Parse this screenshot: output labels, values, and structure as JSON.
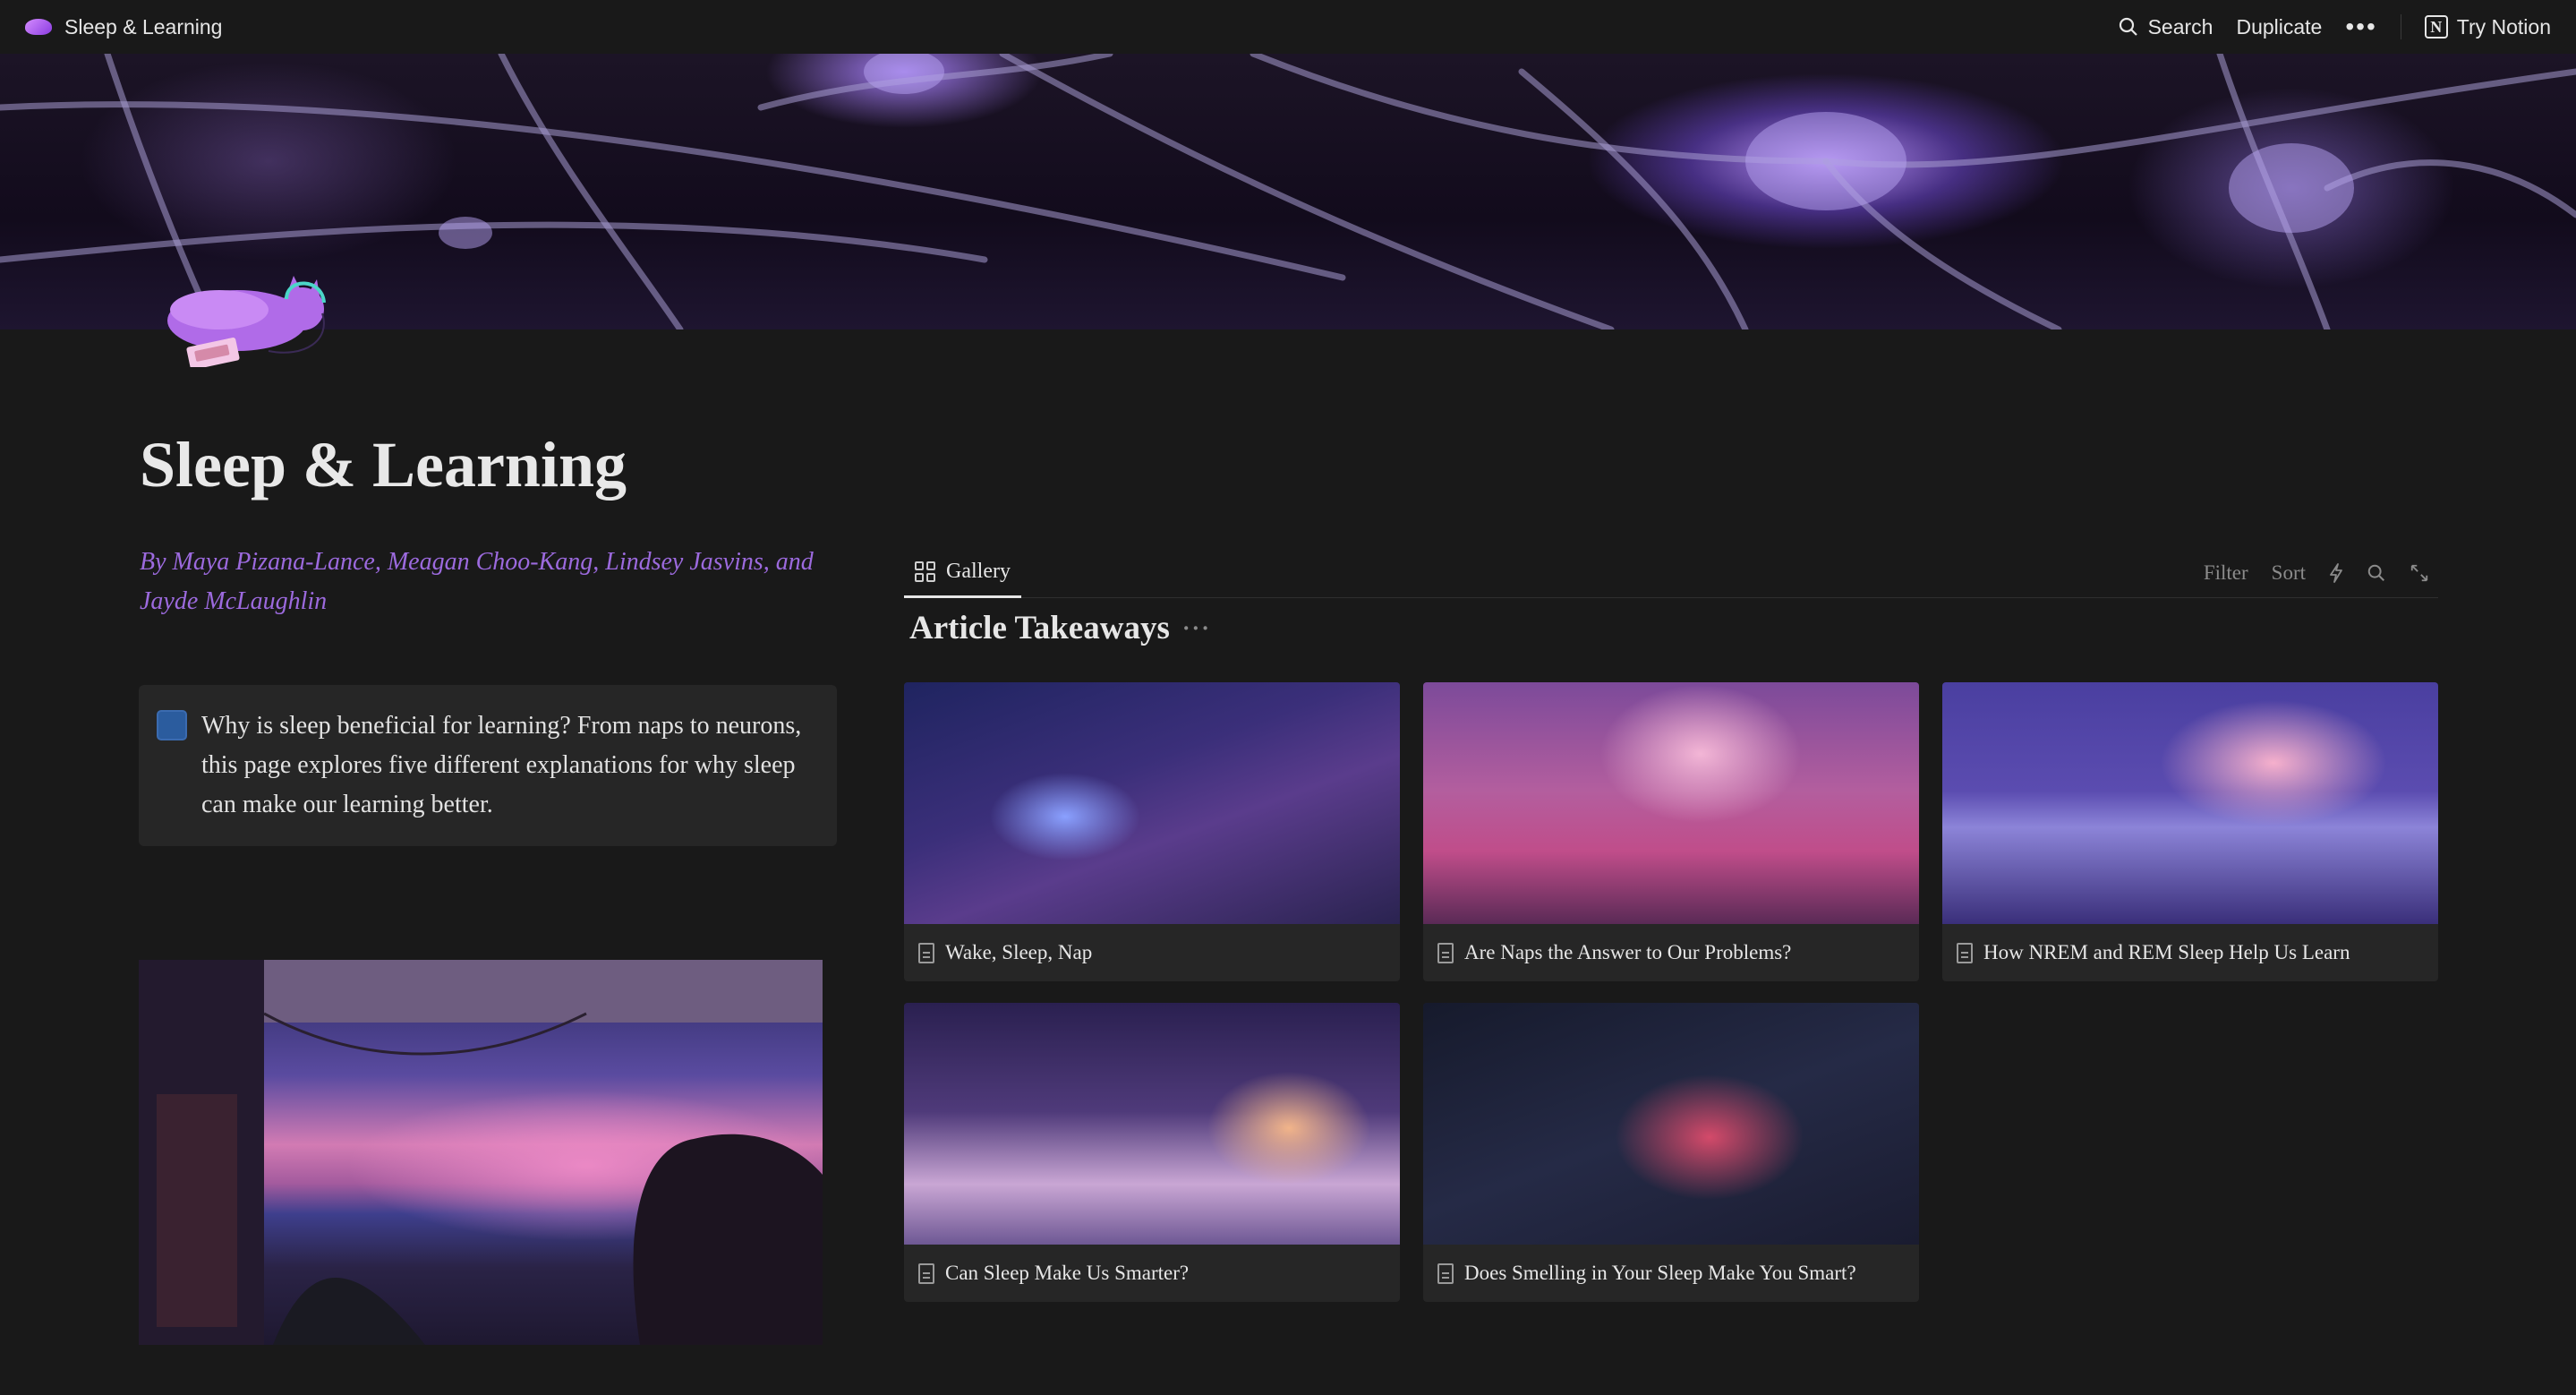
{
  "topbar": {
    "page_title": "Sleep & Learning",
    "search_label": "Search",
    "duplicate_label": "Duplicate",
    "more_label": "•••",
    "try_notion_label": "Try Notion"
  },
  "page": {
    "title": "Sleep & Learning",
    "byline": "By Maya Pizana-Lance, Meagan Choo-Kang, Lindsey Jasvins, and Jayde McLaughlin",
    "callout": "Why is sleep beneficial for learning? From naps to neurons, this page explores five different explanations for why sleep can make our learning better."
  },
  "gallery": {
    "tab_label": "Gallery",
    "tools": {
      "filter": "Filter",
      "sort": "Sort"
    },
    "title": "Article Takeaways",
    "title_more": "···",
    "cards": [
      {
        "title": "Wake, Sleep, Nap"
      },
      {
        "title": "Are Naps the Answer to Our Problems?"
      },
      {
        "title": "How NREM and REM Sleep Help Us Learn"
      },
      {
        "title": "Can Sleep Make Us Smarter?"
      },
      {
        "title": "Does Smelling in Your Sleep Make You Smart?"
      }
    ]
  },
  "colors": {
    "background": "#191919",
    "byline": "#9c6ade",
    "callout_bg": "#262626",
    "callout_icon": "#2b5c9e"
  }
}
